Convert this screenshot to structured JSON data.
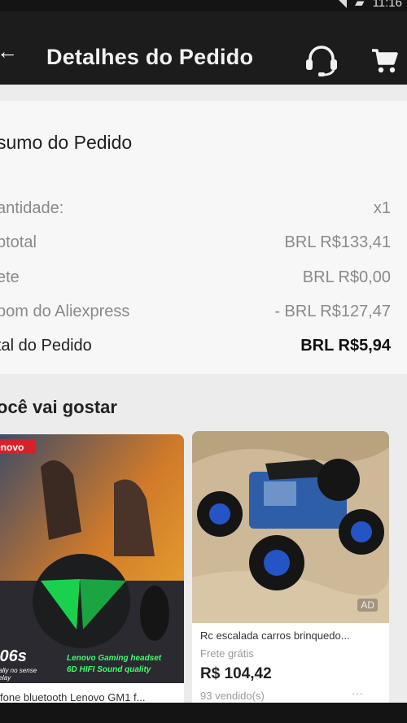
{
  "status": {
    "time": "11:16"
  },
  "header": {
    "title": "Detalhes do Pedido",
    "back_icon": "arrow-back-icon",
    "support_icon": "headset-icon",
    "cart_icon": "cart-icon"
  },
  "summary": {
    "title": "sumo do Pedido",
    "rows": [
      {
        "label": "antidade:",
        "value": "x1"
      },
      {
        "label": "btotal",
        "value": "BRL R$133,41"
      },
      {
        "label": "ete",
        "value": "BRL R$0,00"
      },
      {
        "label": "pom do Aliexpress",
        "value": "- BRL R$127,47"
      },
      {
        "label": "tal do Pedido",
        "value": "BRL R$5,94"
      }
    ]
  },
  "recommendations": {
    "title": "ocê vai gostar",
    "items": [
      {
        "image_brand": "enovo",
        "image_spec": ".06s",
        "image_caption_1": "ually no sense",
        "image_caption_2": "delay",
        "image_tagline_1": "Lenovo Gaming headset",
        "image_tagline_2": "6D HIFI Sound quality",
        "title": "fone bluetooth Lenovo GM1 f..."
      },
      {
        "title": "Rc escalada carros brinquedo...",
        "shipping": "Frete grátis",
        "price": "R$ 104,42",
        "sold": "93  vendido(s)",
        "ad": "AD",
        "more": "···"
      }
    ]
  },
  "colors": {
    "price": "#222222",
    "muted": "#8a8a8a",
    "header_bg": "#1c1c1c"
  }
}
